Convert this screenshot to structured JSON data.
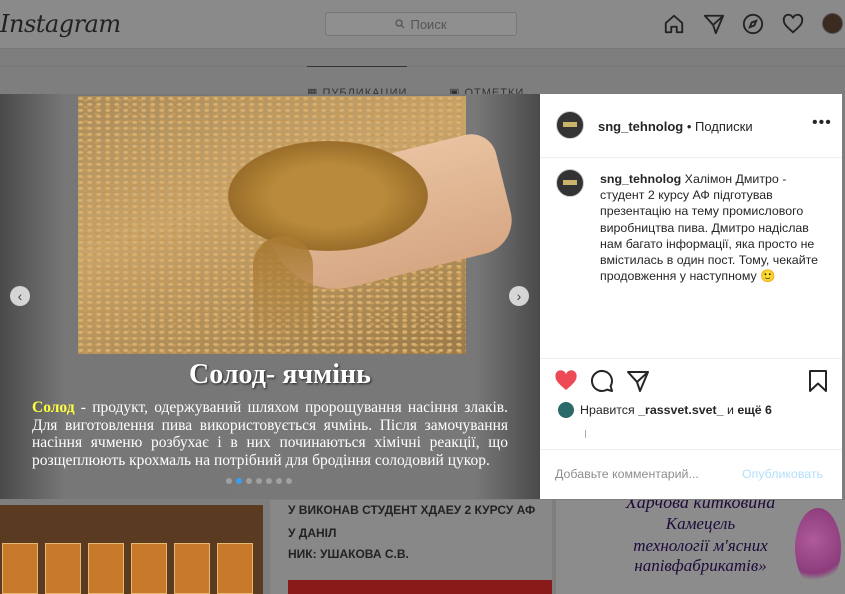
{
  "topbar": {
    "logo": "Instagram",
    "search_placeholder": "Поиск"
  },
  "profile_tabs": [
    {
      "label": "ПУБЛИКАЦИИ"
    },
    {
      "label": "ОТМЕТКИ"
    }
  ],
  "slide": {
    "title": "Солод- ячмінь",
    "keyword": "Солод",
    "body": " - продукт, одержуваний шляхом пророщування насіння злаків. Для виготовлення пива використовується ячмінь. Після замочування насіння ячменю розбухає і в них починаються хімічні реакції, що розщеплюють крохмаль на потрібний для бродіння солодовий цукор.",
    "dots": 7,
    "active_dot": 1
  },
  "panel": {
    "username": "sng_tehnolog",
    "follow_label": "• Подписки",
    "caption_user": "sng_tehnolog",
    "caption_text": " Халімон Дмитро - студент 2 курсу АФ підготував презентацію на тему промислового виробництва пива. Дмитро надіслав нам багато інформації, яка просто не вмістилась в один пост. Тому, чекайте продовження у наступному 🙂",
    "likes_prefix": "Нравится ",
    "likes_user": "_rassvet.svet_",
    "likes_middle": " и ",
    "likes_more": "ещё 6",
    "comment_placeholder": "Добавьте комментарий...",
    "post_label": "Опубликовать"
  },
  "grid": {
    "middle_lines": [
      "У ВИКОНАВ СТУДЕНТ ХДАЕУ 2 КУРСУ АФ",
      "У ДАНІЛ",
      "НИК: УШАКОВА С.В."
    ],
    "right_lines": [
      "Харчова китковина",
      "Камецель",
      "технології м'ясних",
      "напівфабрикатів»"
    ]
  },
  "colors": {
    "like": "#ed4956",
    "link": "#b2dffc",
    "keyword": "#ffff40"
  }
}
